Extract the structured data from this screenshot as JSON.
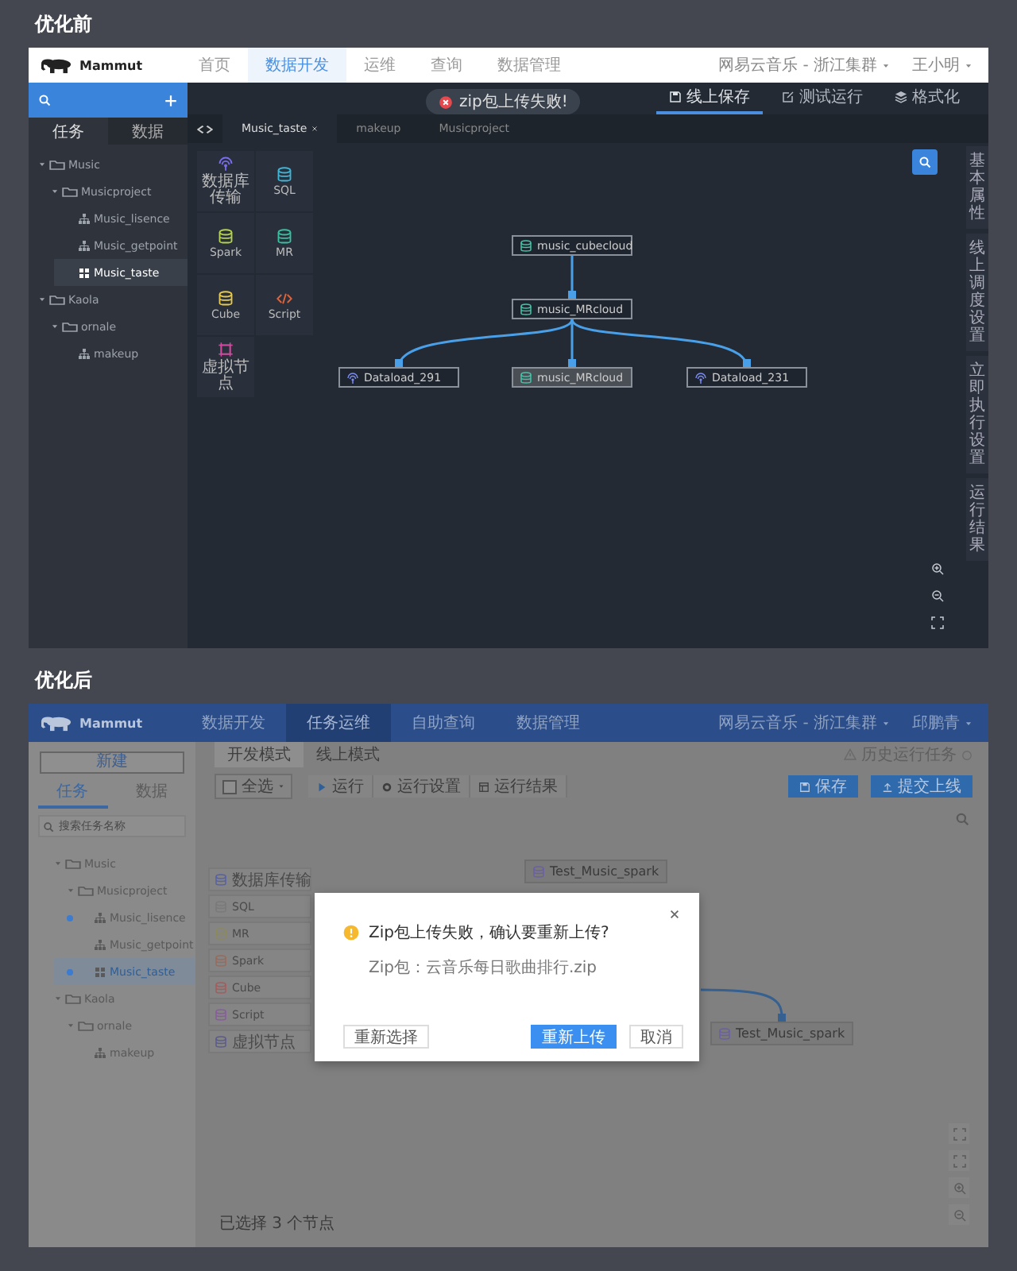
{
  "before": {
    "heading": "优化前",
    "logo": "Mammut",
    "nav": [
      {
        "label": "首页",
        "selected": false
      },
      {
        "label": "数据开发",
        "selected": true
      },
      {
        "label": "运维",
        "selected": false
      },
      {
        "label": "查询",
        "selected": false
      },
      {
        "label": "数据管理",
        "selected": false
      }
    ],
    "cluster": "网易云音乐 - 浙江集群",
    "user": "王小明",
    "sidebar_tabs": [
      {
        "label": "任务",
        "selected": true
      },
      {
        "label": "数据",
        "selected": false
      }
    ],
    "tree": [
      {
        "label": "Music",
        "kind": "folder",
        "expanded": true,
        "selected": false,
        "children": [
          {
            "label": "Musicproject",
            "kind": "folder",
            "expanded": true,
            "selected": false,
            "children": [
              {
                "label": "Music_lisence",
                "kind": "flow",
                "selected": false
              },
              {
                "label": "Music_getpoint",
                "kind": "flow",
                "selected": false
              },
              {
                "label": "Music_taste",
                "kind": "grid",
                "selected": true
              }
            ]
          }
        ]
      },
      {
        "label": "Kaola",
        "kind": "folder",
        "expanded": true,
        "selected": false,
        "children": [
          {
            "label": "ornale",
            "kind": "folder",
            "expanded": true,
            "selected": false,
            "children": [
              {
                "label": "makeup",
                "kind": "flow",
                "selected": false
              }
            ]
          }
        ]
      }
    ],
    "toast": "zip包上传失败!",
    "actions": [
      {
        "label": "线上保存",
        "kind": "save",
        "selected": true
      },
      {
        "label": "测试运行",
        "kind": "edit",
        "selected": false
      },
      {
        "label": "格式化",
        "kind": "layers",
        "selected": false
      }
    ],
    "file_tabs": [
      {
        "label": "Music_taste",
        "selected": true,
        "closable": true
      },
      {
        "label": "makeup",
        "selected": false,
        "closable": false
      },
      {
        "label": "Musicproject",
        "selected": false,
        "closable": false
      }
    ],
    "palette": [
      {
        "label": "数据库传输",
        "kind": "transfer"
      },
      {
        "label": "SQL",
        "kind": "sql"
      },
      {
        "label": "Spark",
        "kind": "spark"
      },
      {
        "label": "MR",
        "kind": "mr"
      },
      {
        "label": "Cube",
        "kind": "cube"
      },
      {
        "label": "Script",
        "kind": "script"
      },
      {
        "label": "虚拟节点",
        "kind": "virtual"
      }
    ],
    "graph": [
      {
        "label": "music_cubecloud",
        "kind": "db",
        "selected": false,
        "children": [
          {
            "label": "music_MRcloud",
            "kind": "db",
            "selected": false,
            "children": [
              {
                "label": "Dataload_291",
                "kind": "cloud",
                "selected": false
              },
              {
                "label": "music_MRcloud",
                "kind": "db",
                "selected": true
              },
              {
                "label": "Dataload_231",
                "kind": "cloud",
                "selected": false
              }
            ]
          }
        ]
      }
    ],
    "side_panels": [
      "基本属性",
      "线上调度设置",
      "立即执行设置",
      "运行结果"
    ]
  },
  "after": {
    "heading": "优化后",
    "logo": "Mammut",
    "nav": [
      {
        "label": "数据开发",
        "selected": false
      },
      {
        "label": "任务运维",
        "selected": true
      },
      {
        "label": "自助查询",
        "selected": false
      },
      {
        "label": "数据管理",
        "selected": false
      }
    ],
    "cluster": "网易云音乐 - 浙江集群",
    "user": "邱鹏青",
    "new_button": "新建",
    "sidebar_tabs": [
      {
        "label": "任务",
        "selected": true
      },
      {
        "label": "数据",
        "selected": false
      }
    ],
    "search": {
      "placeholder": "搜索任务名称"
    },
    "tree": [
      {
        "label": "Music",
        "kind": "folder",
        "expanded": true,
        "selected": false,
        "marked": false,
        "children": [
          {
            "label": "Musicproject",
            "kind": "folder",
            "expanded": true,
            "selected": false,
            "marked": false,
            "children": [
              {
                "label": "Music_lisence",
                "kind": "flow",
                "selected": false,
                "marked": true
              },
              {
                "label": "Music_getpoint",
                "kind": "flow",
                "selected": false,
                "marked": false
              },
              {
                "label": "Music_taste",
                "kind": "grid",
                "selected": true,
                "marked": true
              }
            ]
          }
        ]
      },
      {
        "label": "Kaola",
        "kind": "folder",
        "expanded": true,
        "selected": false,
        "marked": false,
        "children": [
          {
            "label": "ornale",
            "kind": "folder",
            "expanded": true,
            "selected": false,
            "marked": false,
            "children": [
              {
                "label": "makeup",
                "kind": "flow",
                "selected": false,
                "marked": false
              }
            ]
          }
        ]
      }
    ],
    "mode_tabs": [
      {
        "label": "开发模式",
        "selected": true
      },
      {
        "label": "线上模式",
        "selected": false
      }
    ],
    "history": "历史运行任务",
    "select_all": {
      "label": "全选",
      "checked": false
    },
    "run_tools": [
      {
        "label": "运行",
        "kind": "play"
      },
      {
        "label": "运行设置",
        "kind": "gear"
      },
      {
        "label": "运行结果",
        "kind": "table"
      }
    ],
    "primary_actions": [
      {
        "label": "保存",
        "kind": "save"
      },
      {
        "label": "提交上线",
        "kind": "upload"
      }
    ],
    "palette": [
      {
        "label": "数据库传输",
        "kind": "transfer"
      },
      {
        "label": "SQL",
        "kind": "sql"
      },
      {
        "label": "MR",
        "kind": "mr"
      },
      {
        "label": "Spark",
        "kind": "spark"
      },
      {
        "label": "Cube",
        "kind": "cube"
      },
      {
        "label": "Script",
        "kind": "script"
      },
      {
        "label": "虚拟节点",
        "kind": "virtual"
      }
    ],
    "graph": [
      {
        "label": "Test_Music_spark",
        "kind": "db",
        "children": [
          {
            "label": "Test_Music_spark",
            "kind": "db"
          }
        ]
      }
    ],
    "selection_note": "已选择 3 个节点",
    "dialog": {
      "message": "Zip包上传失败，确认要重新上传?",
      "detail": "Zip包：云音乐每日歌曲排行.zip",
      "buttons": [
        {
          "label": "重新选择",
          "kind": "secondary"
        },
        {
          "label": "重新上传",
          "kind": "primary"
        },
        {
          "label": "取消",
          "kind": "secondary"
        }
      ]
    }
  }
}
